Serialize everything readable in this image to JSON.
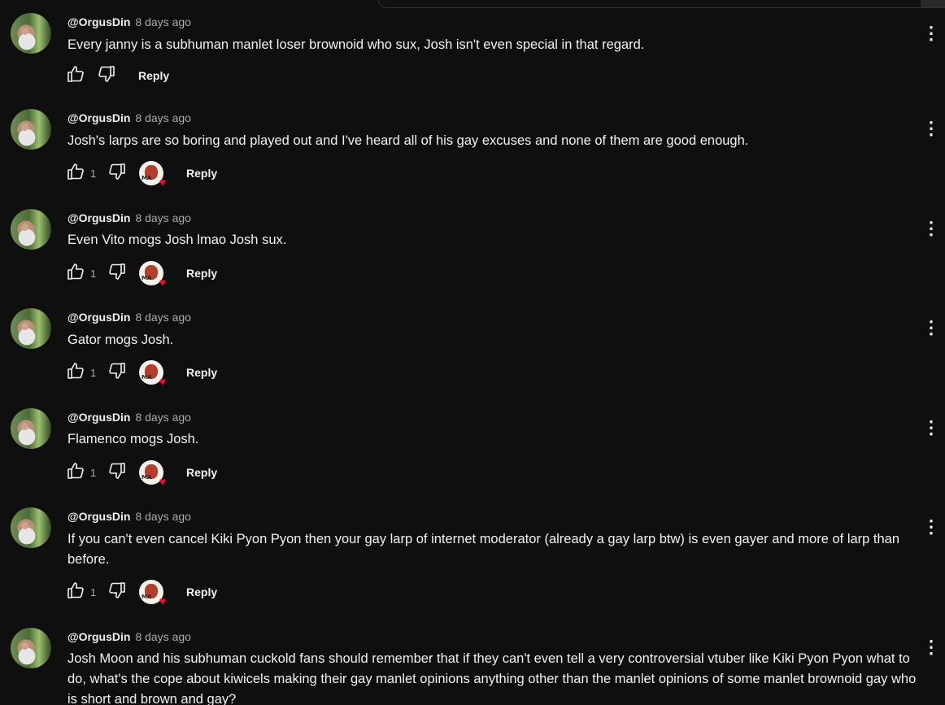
{
  "comments": [
    {
      "author": "@OrgusDin",
      "time": "8 days ago",
      "text": "Every janny is a subhuman manlet loser brownoid who sux, Josh isn't even special in that regard.",
      "likes": "",
      "reply": "Reply",
      "creator_heart": false
    },
    {
      "author": "@OrgusDin",
      "time": "8 days ago",
      "text": "Josh's larps are so boring and played out and I've heard all of his gay excuses and none of them are good enough.",
      "likes": "1",
      "reply": "Reply",
      "creator_heart": true
    },
    {
      "author": "@OrgusDin",
      "time": "8 days ago",
      "text": "Even Vito mogs Josh lmao Josh sux.",
      "likes": "1",
      "reply": "Reply",
      "creator_heart": true
    },
    {
      "author": "@OrgusDin",
      "time": "8 days ago",
      "text": "Gator mogs Josh.",
      "likes": "1",
      "reply": "Reply",
      "creator_heart": true
    },
    {
      "author": "@OrgusDin",
      "time": "8 days ago",
      "text": "Flamenco mogs Josh.",
      "likes": "1",
      "reply": "Reply",
      "creator_heart": true
    },
    {
      "author": "@OrgusDin",
      "time": "8 days ago",
      "text": "If you can't even cancel Kiki Pyon Pyon then your gay larp of internet moderator (already a gay larp btw) is even gayer and more of larp than before.",
      "likes": "1",
      "reply": "Reply",
      "creator_heart": true
    },
    {
      "author": "@OrgusDin",
      "time": "8 days ago",
      "text": "Josh Moon and his subhuman cuckold fans should remember that if they can't even tell a very controversial vtuber like Kiki Pyon Pyon what to do, what's the cope about kiwicels making their gay manlet opinions anything other than the manlet opinions of some manlet brownoid gay who is short and brown and gay?",
      "likes": "",
      "reply": "",
      "creator_heart": false
    }
  ],
  "icons": {
    "like": "thumbs-up-icon",
    "dislike": "thumbs-down-icon",
    "more": "more-vertical-icon",
    "heart": "creator-heart-icon"
  },
  "badge_text": "MA",
  "colors": {
    "background": "#0f0f0f",
    "text": "#f1f1f1",
    "muted": "#aaaaaa",
    "heart": "#ff0033"
  }
}
